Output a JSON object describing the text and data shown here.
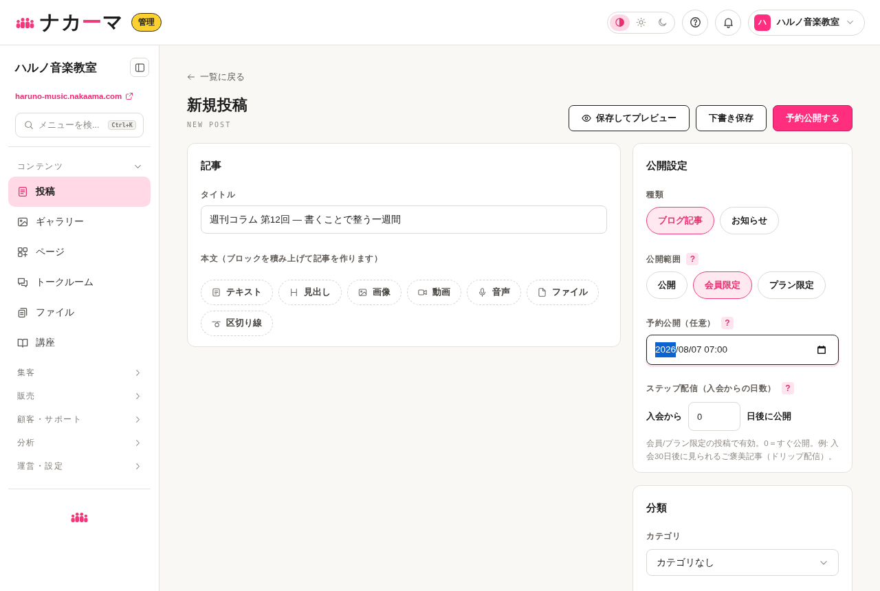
{
  "header": {
    "logo": {
      "parts": [
        {
          "text": "ナカ",
          "accent": false
        },
        {
          "text": "ー",
          "accent": true
        },
        {
          "text": "マ",
          "accent": false
        }
      ],
      "badge": "管理"
    },
    "theme_options": [
      {
        "kind": "auto",
        "selected": true
      },
      {
        "kind": "light",
        "selected": false
      },
      {
        "kind": "dark",
        "selected": false
      }
    ],
    "account": {
      "avatar": "ハ",
      "name": "ハルノ音楽教室"
    }
  },
  "sidebar": {
    "title": "ハルノ音楽教室",
    "site_link": "haruno-music.nakaama.com",
    "search": {
      "placeholder": "メニューを検...",
      "shortcut": "Ctrl+K"
    },
    "sections": [
      {
        "label": "コンテンツ",
        "expanded": true,
        "items": [
          {
            "kind": "post",
            "label": "投稿",
            "selected": true
          },
          {
            "kind": "gallery",
            "label": "ギャラリー",
            "selected": false
          },
          {
            "kind": "page",
            "label": "ページ",
            "selected": false
          },
          {
            "kind": "talk",
            "label": "トークルーム",
            "selected": false
          },
          {
            "kind": "file",
            "label": "ファイル",
            "selected": false
          },
          {
            "kind": "course",
            "label": "講座",
            "selected": false
          }
        ]
      },
      {
        "label": "集客",
        "expanded": false
      },
      {
        "label": "販売",
        "expanded": false
      },
      {
        "label": "顧客・サポート",
        "expanded": false
      },
      {
        "label": "分析",
        "expanded": false
      },
      {
        "label": "運営・設定",
        "expanded": false
      }
    ]
  },
  "page": {
    "back_link": "一覧に戻る",
    "title": "新規投稿",
    "subtitle": "NEW POST",
    "actions": [
      {
        "kind": "preview",
        "label": "保存してプレビュー"
      },
      {
        "kind": "draft",
        "label": "下書き保存"
      },
      {
        "kind": "publish",
        "label": "予約公開する"
      }
    ]
  },
  "article": {
    "title": "記事",
    "title_field": {
      "label": "タイトル",
      "value": "週刊コラム 第12回 — 書くことで整う一週間"
    },
    "body": {
      "label": "本文（ブロックを積み上げて記事を作ります）",
      "blocks": [
        {
          "kind": "text",
          "label": "テキスト"
        },
        {
          "kind": "heading",
          "label": "見出し"
        },
        {
          "kind": "image",
          "label": "画像"
        },
        {
          "kind": "video",
          "label": "動画"
        },
        {
          "kind": "audio",
          "label": "音声"
        },
        {
          "kind": "file",
          "label": "ファイル"
        },
        {
          "kind": "divider",
          "label": "区切り線"
        }
      ]
    }
  },
  "publish": {
    "title": "公開設定",
    "type": {
      "label": "種類",
      "options": [
        {
          "label": "ブログ記事",
          "selected": true
        },
        {
          "label": "お知らせ",
          "selected": false
        }
      ]
    },
    "visibility": {
      "label": "公開範囲",
      "help": "?",
      "options": [
        {
          "label": "公開",
          "selected": false
        },
        {
          "label": "会員限定",
          "selected": true
        },
        {
          "label": "プラン限定",
          "selected": false
        }
      ]
    },
    "schedule": {
      "label": "予約公開（任意）",
      "help": "?",
      "focused": true,
      "segments": [
        {
          "text": "2026",
          "selected": true
        },
        {
          "text": "/08/07 07:00",
          "selected": false
        }
      ]
    },
    "step": {
      "label": "ステップ配信（入会からの日数）",
      "help": "?",
      "prefix": "入会から",
      "value": "0",
      "suffix": "日後に公開",
      "note": "会員/プラン限定の投稿で有効。0＝すぐ公開。例: 入会30日後に見られるご褒美記事（ドリップ配信）。"
    }
  },
  "classification": {
    "title": "分類",
    "category": {
      "label": "カテゴリ",
      "value": "カテゴリなし"
    }
  }
}
